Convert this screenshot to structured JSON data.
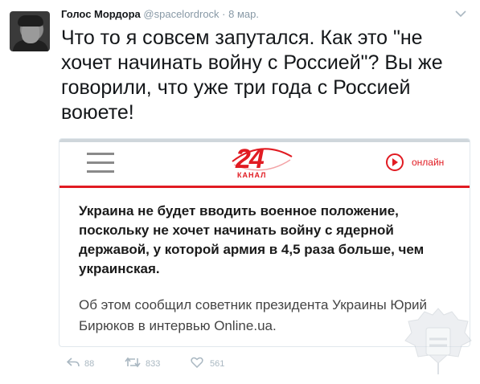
{
  "tweet": {
    "author_name": "Голос Мордора",
    "handle": "@spacelordrock",
    "separator": "·",
    "date": "8 мар.",
    "text": "Что то я совсем запутался. Как это \"не хочет начинать войну с Россией\"? Вы же говорили, что уже три года с Россией воюете!",
    "avatar_icon": "user-avatar",
    "menu_icon": "chevron-down-icon"
  },
  "card": {
    "nav": {
      "menu_icon": "hamburger-menu-icon",
      "logo_number": "24",
      "logo_sub": "КАНАЛ",
      "online_label": "онлайн",
      "online_icon": "play-circle-icon",
      "accent_color": "#e11b22"
    },
    "lead": "Украина не будет вводить военное положение, поскольку не хочет начинать войну с ядерной державой, у которой армия в 4,5 раза больше, чем украинская.",
    "paragraph": "Об этом сообщил советник президента Украины Юрий Бирюков в интервью Online.ua."
  },
  "actions": {
    "reply_icon": "reply-icon",
    "reply_count": "88",
    "retweet_icon": "retweet-icon",
    "retweet_count": "833",
    "like_icon": "heart-icon",
    "like_count": "561"
  },
  "watermark_icon": "coat-of-arms-watermark"
}
